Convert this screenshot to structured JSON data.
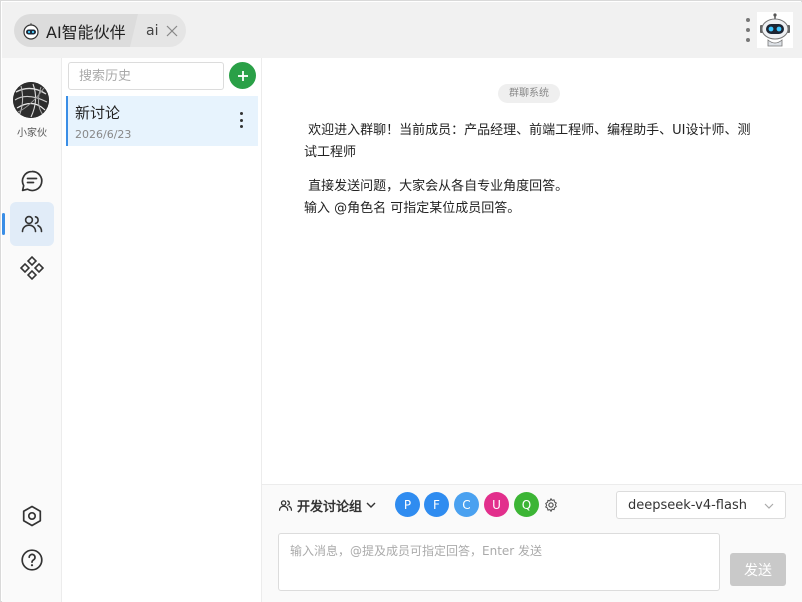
{
  "titlebar": {
    "tabs": [
      {
        "label": "AI智能伙伴",
        "icon": "robot-icon"
      },
      {
        "label": "ai",
        "icon": "close-icon"
      }
    ]
  },
  "rail": {
    "user_name": "小家伙",
    "items": [
      {
        "name": "chat",
        "icon": "message-icon",
        "active": false
      },
      {
        "name": "group",
        "icon": "users-icon",
        "active": true
      },
      {
        "name": "apps",
        "icon": "grid-icon",
        "active": false
      }
    ],
    "bottom": [
      {
        "name": "settings",
        "icon": "hexagon-settings-icon"
      },
      {
        "name": "help",
        "icon": "help-icon"
      }
    ]
  },
  "history": {
    "search_placeholder": "搜索历史",
    "sessions": [
      {
        "title": "新讨论",
        "date": "2026/6/23"
      }
    ]
  },
  "chat": {
    "system_tag": "群聊系统",
    "message1": "欢迎进入群聊！当前成员：产品经理、前端工程师、编程助手、UI设计师、测试工程师",
    "message2_line1": "直接发送问题，大家会从各自专业角度回答。",
    "message2_line2": "输入 @角色名 可指定某位成员回答。"
  },
  "footer": {
    "group_label": "开发讨论组",
    "members": [
      {
        "initial": "P",
        "color": "#2f8cf0"
      },
      {
        "initial": "F",
        "color": "#2f8cf0"
      },
      {
        "initial": "C",
        "color": "#4aa1f0"
      },
      {
        "initial": "U",
        "color": "#e22f8c"
      },
      {
        "initial": "Q",
        "color": "#3cb535"
      }
    ],
    "model": "deepseek-v4-flash",
    "input_placeholder": "输入消息，@提及成员可指定回答，Enter 发送",
    "send_label": "发送"
  },
  "colors": {
    "accent": "#3a8ee6",
    "add_button": "#2aa047",
    "session_bg": "#e7f3fd"
  }
}
